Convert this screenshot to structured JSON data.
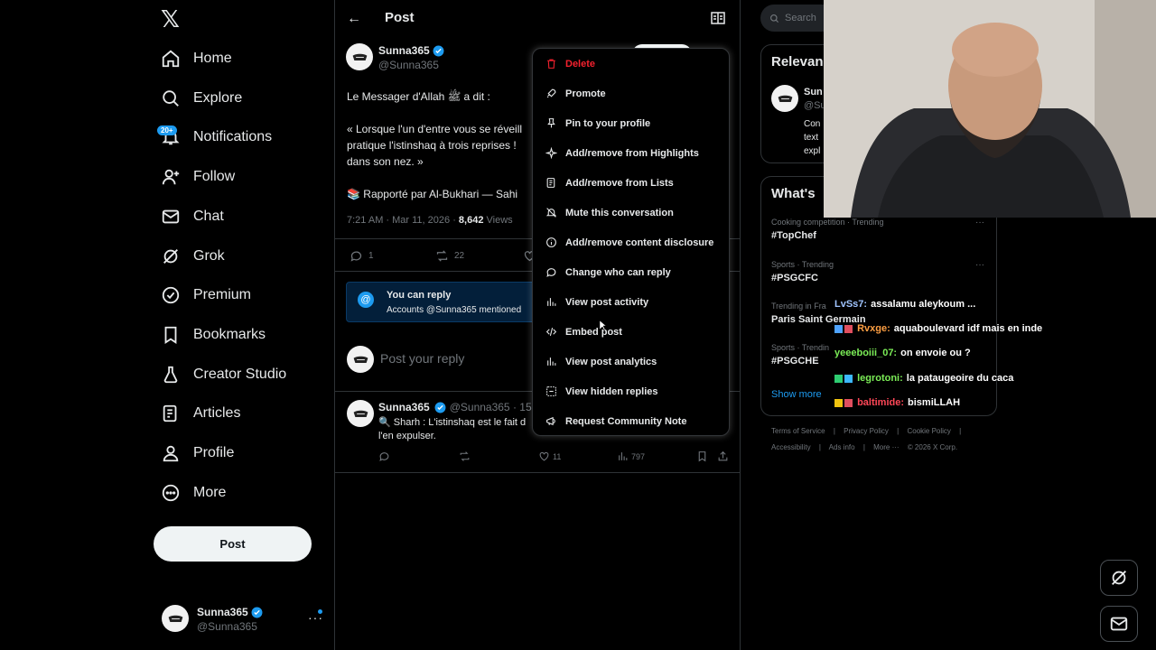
{
  "nav": {
    "logo": "𝕏",
    "items": [
      {
        "label": "Home",
        "icon": "home-icon"
      },
      {
        "label": "Explore",
        "icon": "search-icon"
      },
      {
        "label": "Notifications",
        "icon": "bell-icon"
      },
      {
        "label": "Follow",
        "icon": "follow-icon"
      },
      {
        "label": "Chat",
        "icon": "mail-icon"
      },
      {
        "label": "Grok",
        "icon": "grok-icon"
      },
      {
        "label": "Premium",
        "icon": "premium-icon"
      },
      {
        "label": "Bookmarks",
        "icon": "bookmark-icon"
      },
      {
        "label": "Creator Studio",
        "icon": "flask-icon"
      },
      {
        "label": "Articles",
        "icon": "article-icon"
      },
      {
        "label": "Profile",
        "icon": "profile-icon"
      },
      {
        "label": "More",
        "icon": "more-circle-icon"
      }
    ],
    "notif_badge": "20+",
    "post_button": "Post",
    "account": {
      "name": "Sunna365",
      "handle": "@Sunna365",
      "more": "···"
    }
  },
  "main": {
    "header_title": "Post",
    "author": {
      "name": "Sunna365",
      "handle": "@Sunna365"
    },
    "tweet_lines": [
      "Le Messager d'Allah ﷺ a dit :",
      "« Lorsque l'un d'entre vous se réveill",
      "pratique l'istinshaq à trois reprises !",
      "dans son nez. »",
      "📚 Rapporté par Al-Bukhari — Sahi"
    ],
    "meta": {
      "time": "7:21 AM · Mar 11, 2026 · ",
      "views_count": "8,642",
      "views_label": " Views"
    },
    "actions": {
      "replies": "1",
      "reposts": "22"
    },
    "reply_restriction": {
      "icon": "@",
      "title": "You can reply",
      "subtitle": "Accounts @Sunna365 mentioned"
    },
    "compose_placeholder": "Post your reply",
    "reply": {
      "name": "Sunna365",
      "meta": "@Sunna365 · 15h",
      "text_line1": "🔍 Sharh : L'istinshaq est le fait d",
      "text_line2": "l'en expulser.",
      "likes": "11",
      "views": "797"
    }
  },
  "menu": {
    "items": [
      {
        "label": "Delete",
        "icon": "trash-icon",
        "danger": true
      },
      {
        "label": "Promote",
        "icon": "rocket-icon"
      },
      {
        "label": "Pin to your profile",
        "icon": "pin-icon"
      },
      {
        "label": "Add/remove from Highlights",
        "icon": "sparkle-icon"
      },
      {
        "label": "Add/remove from Lists",
        "icon": "list-icon"
      },
      {
        "label": "Mute this conversation",
        "icon": "mute-icon"
      },
      {
        "label": "Add/remove content disclosure",
        "icon": "info-icon"
      },
      {
        "label": "Change who can reply",
        "icon": "chat-bubble-icon"
      },
      {
        "label": "View post activity",
        "icon": "bar-chart-icon"
      },
      {
        "label": "Embed post",
        "icon": "code-icon"
      },
      {
        "label": "View post analytics",
        "icon": "analytics-icon"
      },
      {
        "label": "View hidden replies",
        "icon": "hidden-replies-icon"
      },
      {
        "label": "Request Community Note",
        "icon": "megaphone-icon"
      }
    ]
  },
  "right": {
    "search_placeholder": "Search",
    "relevant_title": "Relevan",
    "relevant_user": {
      "name": "Sun",
      "handle": "@Su",
      "desc": [
        "Con",
        "text",
        "expl"
      ]
    },
    "whats_title": "What's",
    "trends": [
      {
        "meta": "Cooking competition · Trending",
        "name": "#TopChef"
      },
      {
        "meta": "Sports · Trending",
        "name": "#PSGCFC"
      },
      {
        "meta": "Trending in Fra",
        "name": "Paris Saint Germain"
      },
      {
        "meta": "Sports · Trendin",
        "name": "#PSGCHE"
      }
    ],
    "show_more": "Show more",
    "footer_line1": [
      "Terms of Service",
      "|",
      "Privacy Policy",
      "|",
      "Cookie Policy",
      "|"
    ],
    "footer_line2": [
      "Accessibility",
      "|",
      "Ads info",
      "|",
      "More ···",
      "© 2026 X Corp."
    ]
  },
  "chat_overlay": [
    {
      "user": "LvSs7:",
      "message": "assalamu aleykoum ...",
      "color": "#a0c4ff"
    },
    {
      "user": "Rvxge:",
      "message": "aquaboulevard idf mais en inde",
      "color": "#ff9f43"
    },
    {
      "user": "yeeeboiii_07:",
      "message": "on envoie ou ?",
      "color": "#7bed57"
    },
    {
      "user": "legrotoni:",
      "message": "la pataugeoire du caca",
      "color": "#7bed57"
    },
    {
      "user": "baltimide:",
      "message": "bismiLLAH",
      "color": "#ff4757"
    }
  ],
  "colors": {
    "accent": "#1d9bf0",
    "danger": "#f4212e",
    "bg": "#000000"
  }
}
